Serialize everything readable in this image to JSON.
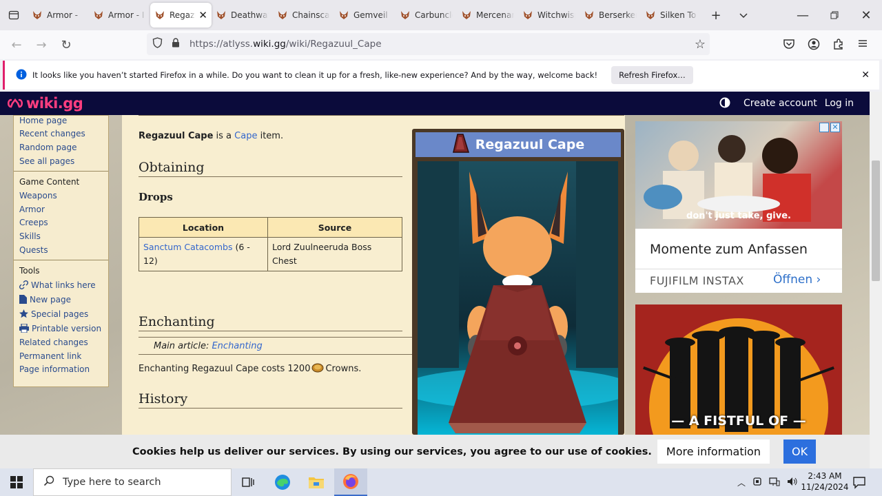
{
  "browser": {
    "tabs": [
      {
        "label": "Armor -"
      },
      {
        "label": "Armor - I"
      },
      {
        "label": "Regazuul",
        "active": true
      },
      {
        "label": "Deathwatch"
      },
      {
        "label": "Chainscale"
      },
      {
        "label": "Gemveil"
      },
      {
        "label": "Carbuncle"
      },
      {
        "label": "Mercenary"
      },
      {
        "label": "Witchwisp"
      },
      {
        "label": "Berserker"
      },
      {
        "label": "Silken To"
      }
    ],
    "url_prefix": "https://atlyss.",
    "url_domain": "wiki.gg",
    "url_path": "/wiki/Regazuul_Cape",
    "notification": "It looks like you haven’t started Firefox in a while. Do you want to clean it up for a fresh, like-new experience? And by the way, welcome back!",
    "notification_button": "Refresh Firefox…"
  },
  "wiki": {
    "logo": "wiki.gg",
    "create_account": "Create account",
    "login": "Log in"
  },
  "sidebar": {
    "nav": [
      "Home page",
      "Recent changes",
      "Random page",
      "See all pages"
    ],
    "game_heading": "Game Content",
    "game": [
      "Weapons",
      "Armor",
      "Creeps",
      "Skills",
      "Quests"
    ],
    "tools_heading": "Tools",
    "tools": [
      {
        "label": "What links here",
        "icon": "link-icon"
      },
      {
        "label": "New page",
        "icon": "page-icon"
      },
      {
        "label": "Special pages",
        "icon": "star-icon"
      },
      {
        "label": "Printable version",
        "icon": "printer-icon"
      },
      {
        "label": "Related changes"
      },
      {
        "label": "Permanent link"
      },
      {
        "label": "Page information"
      }
    ]
  },
  "article": {
    "intro_bold": "Regazuul Cape",
    "intro_mid": " is a ",
    "intro_link": "Cape",
    "intro_end": " item.",
    "obtaining": "Obtaining",
    "drops": "Drops",
    "table_headers": [
      "Location",
      "Source"
    ],
    "table_row": {
      "location_link": "Sanctum Catacombs",
      "location_rest": " (6 - 12)",
      "source": "Lord Zuulneeruda Boss Chest"
    },
    "enchanting": "Enchanting",
    "main_article_label": "Main article: ",
    "main_article_link": "Enchanting",
    "enchant_text_pre": "Enchanting Regazuul Cape costs 1200 ",
    "enchant_text_post": " Crowns.",
    "history": "History"
  },
  "infobox": {
    "title": "Regazuul Cape"
  },
  "ads": {
    "ad1_slogan": "don't just take, give.",
    "ad1_headline": "Momente zum Anfassen",
    "ad1_brand": "FUJIFILM INSTAX",
    "ad1_cta": "Öffnen",
    "ad2_text": "— A FISTFUL OF —"
  },
  "cookie": {
    "text": "Cookies help us deliver our services. By using our services, you agree to our use of cookies.",
    "more": "More information",
    "ok": "OK"
  },
  "taskbar": {
    "search_placeholder": "Type here to search",
    "time": "2:43 AM",
    "date": "11/24/2024"
  },
  "colors": {
    "wiki_header": "#0b0b3b",
    "logo": "#ff3d7f",
    "link": "#3366cc",
    "infobox_title": "#6a88c9"
  }
}
